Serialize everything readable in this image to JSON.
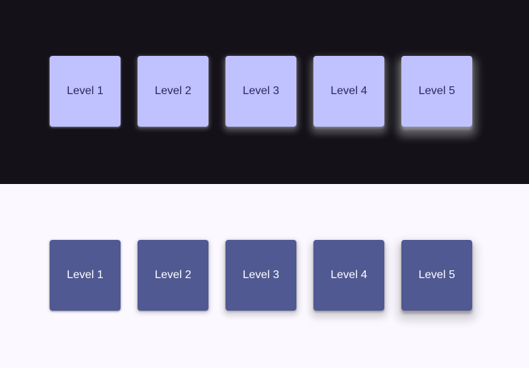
{
  "dark_theme": {
    "background": "#141218",
    "surface": "#c0c1ff",
    "on_surface": "#292a60",
    "tiles": [
      "Level 1",
      "Level 2",
      "Level 3",
      "Level 4",
      "Level 5"
    ]
  },
  "light_theme": {
    "background": "#fbf8ff",
    "surface": "#515992",
    "on_surface": "#ffffff",
    "tiles": [
      "Level 1",
      "Level 2",
      "Level 3",
      "Level 4",
      "Level 5"
    ]
  }
}
